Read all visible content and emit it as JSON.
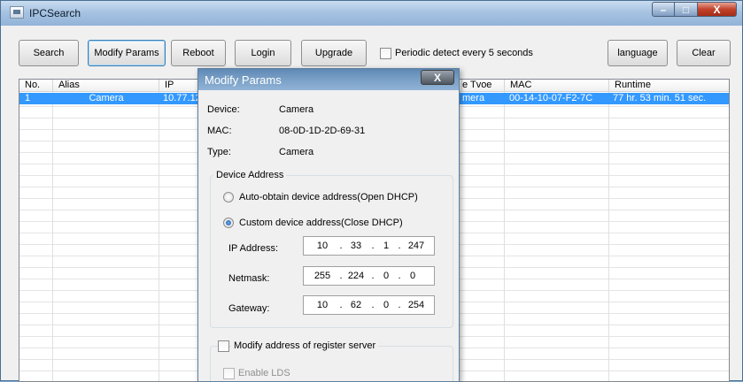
{
  "window": {
    "title": "IPCSearch",
    "minimize": "–",
    "maximize": "□",
    "close": "X"
  },
  "toolbar": {
    "search": "Search",
    "modify_params": "Modify Params",
    "reboot": "Reboot",
    "login": "Login",
    "upgrade": "Upgrade",
    "periodic_detect": "Periodic detect every 5 seconds",
    "periodic_detect_checked": false,
    "language": "language",
    "clear": "Clear"
  },
  "table": {
    "columns": {
      "no": "No.",
      "alias": "Alias",
      "ip": "IP",
      "device_type": "e Tvoe",
      "mac": "MAC",
      "runtime": "Runtime"
    },
    "rows": [
      {
        "no": "1",
        "alias": "Camera",
        "ip": "10.77.12",
        "device_type": "mera",
        "mac": "00-14-10-07-F2-7C",
        "runtime": "77 hr. 53 min. 51 sec."
      }
    ]
  },
  "dialog": {
    "title": "Modify Params",
    "close": "X",
    "device_label": "Device:",
    "device_value": "Camera",
    "mac_label": "MAC:",
    "mac_value": "08-0D-1D-2D-69-31",
    "type_label": "Type:",
    "type_value": "Camera",
    "address_group": "Device Address",
    "auto_dhcp": "Auto-obtain device address(Open DHCP)",
    "custom_dhcp": "Custom device address(Close DHCP)",
    "ip_label": "IP Address:",
    "ip": [
      "10",
      "33",
      "1",
      "247"
    ],
    "netmask_label": "Netmask:",
    "netmask": [
      "255",
      "224",
      "0",
      "0"
    ],
    "gateway_label": "Gateway:",
    "gateway": [
      "10",
      "62",
      "0",
      "254"
    ],
    "register_server": "Modify address of register server",
    "enable_lds": "Enable LDS"
  }
}
